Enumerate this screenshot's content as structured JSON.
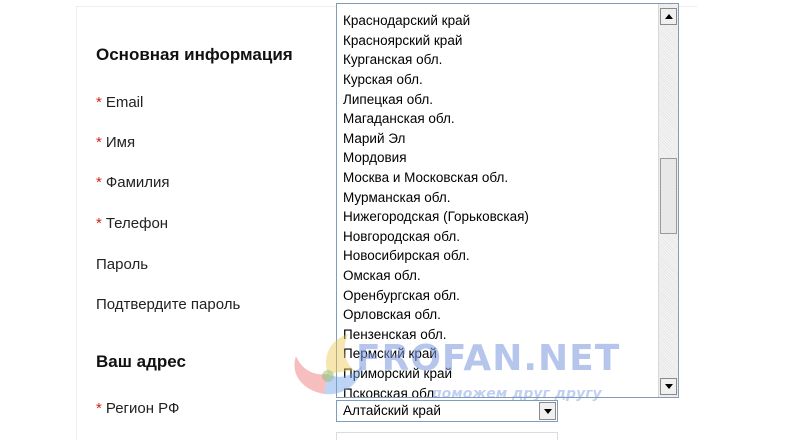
{
  "form": {
    "section_basic_title": "Основная информация",
    "section_address_title": "Ваш адрес",
    "fields": [
      {
        "label": "Email",
        "required": true
      },
      {
        "label": "Имя",
        "required": true
      },
      {
        "label": "Фамилия",
        "required": true
      },
      {
        "label": "Телефон",
        "required": true
      },
      {
        "label": "Пароль",
        "required": false
      },
      {
        "label": "Подтвердите пароль",
        "required": false
      }
    ],
    "region_field": {
      "label": "Регион РФ",
      "required": true
    },
    "required_marker": "*"
  },
  "region_select": {
    "selected_value": "Алтайский край",
    "options": [
      "Краснодарский край",
      "Красноярский край",
      "Курганская обл.",
      "Курская обл.",
      "Липецкая обл.",
      "Магаданская обл.",
      "Марий Эл",
      "Мордовия",
      "Москва и Московская обл.",
      "Мурманская обл.",
      "Нижегородская (Горьковская)",
      "Новгородская обл.",
      "Новосибирская обл.",
      "Омская обл.",
      "Оренбургская обл.",
      "Орловская обл.",
      "Пензенская обл.",
      "Пермский край",
      "Приморский край",
      "Псковская обл."
    ]
  },
  "watermark": {
    "text": "FROFAN.NET",
    "subtext": "поможем друг другу"
  },
  "colors": {
    "required_marker": "#d42020",
    "select_border": "#7f9db9",
    "watermark": "#7896dc"
  }
}
